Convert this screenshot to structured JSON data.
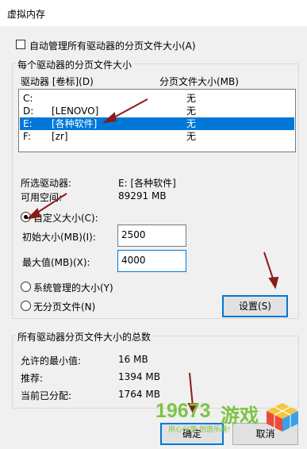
{
  "window": {
    "title": "虚拟内存"
  },
  "auto_manage": {
    "label": "自动管理所有驱动器的分页文件大小(A)",
    "checked": false
  },
  "per_drive_group": {
    "title": "每个驱动器的分页文件大小"
  },
  "drive_list": {
    "headers": {
      "drive": "驱动器 [卷标](D)",
      "paging": "分页文件大小(MB)"
    },
    "rows": [
      {
        "drive": "C:",
        "label": "",
        "paging": "无",
        "selected": false
      },
      {
        "drive": "D:",
        "label": "[LENOVO]",
        "paging": "无",
        "selected": false
      },
      {
        "drive": "E:",
        "label": "[各种软件]",
        "paging": "无",
        "selected": true
      },
      {
        "drive": "F:",
        "label": "[zr]",
        "paging": "无",
        "selected": false
      }
    ]
  },
  "selected_drive": {
    "label": "所选驱动器:",
    "value": "E:  [各种软件]"
  },
  "free_space": {
    "label": "可用空间:",
    "value": "89291 MB"
  },
  "custom_size": {
    "label": "自定义大小(C):",
    "selected": true
  },
  "initial_size": {
    "label": "初始大小(MB)(I):",
    "value": "2500"
  },
  "max_size": {
    "label": "最大值(MB)(X):",
    "value": "4000"
  },
  "system_managed": {
    "label": "系统管理的大小(Y)",
    "selected": false
  },
  "no_paging": {
    "label": "无分页文件(N)",
    "selected": false
  },
  "set_button": {
    "label": "设置(S)"
  },
  "totals_group": {
    "title": "所有驱动器分页文件大小的总数"
  },
  "totals": {
    "min_label": "允许的最小值:",
    "min_value": "16 MB",
    "recommended_label": "推荐:",
    "recommended_value": "1394 MB",
    "current_label": "当前已分配:",
    "current_value": "1764 MB"
  },
  "buttons": {
    "ok": "确定",
    "cancel": "取消"
  },
  "watermark": {
    "number": "19673",
    "text": "游戏",
    "slogan": "用心分享 创造乐趣!"
  },
  "colors": {
    "selection": "#0078d7",
    "annotation_arrow": "#8b1a1a",
    "watermark": "#7cc442"
  }
}
